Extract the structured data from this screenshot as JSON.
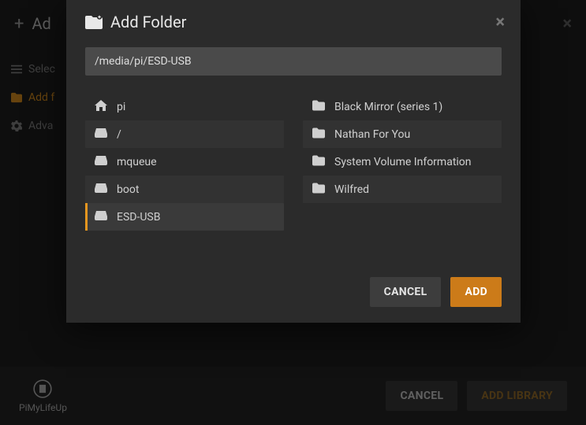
{
  "outer": {
    "title_fragment": "Ad",
    "close_glyph": "×",
    "side": {
      "select_label": "Selec",
      "add_label": "Add f",
      "advanced_label": "Adva"
    },
    "footer": {
      "brand": "PiMyLifeUp",
      "cancel": "CANCEL",
      "add_library": "ADD LIBRARY"
    }
  },
  "modal": {
    "title": "Add Folder",
    "close_glyph": "×",
    "path_value": "/media/pi/ESD-USB",
    "path_placeholder": "",
    "drives": [
      {
        "icon": "home",
        "label": "pi",
        "alt": false,
        "selected": false
      },
      {
        "icon": "drive",
        "label": "/",
        "alt": true,
        "selected": false
      },
      {
        "icon": "drive",
        "label": "mqueue",
        "alt": false,
        "selected": false
      },
      {
        "icon": "drive",
        "label": "boot",
        "alt": true,
        "selected": false
      },
      {
        "icon": "drive",
        "label": "ESD-USB",
        "alt": false,
        "selected": true
      }
    ],
    "folders": [
      {
        "label": "Black Mirror (series 1)",
        "alt": false
      },
      {
        "label": "Nathan For You",
        "alt": true
      },
      {
        "label": "System Volume Information",
        "alt": false
      },
      {
        "label": "Wilfred",
        "alt": true
      }
    ],
    "cancel": "CANCEL",
    "add": "ADD"
  }
}
